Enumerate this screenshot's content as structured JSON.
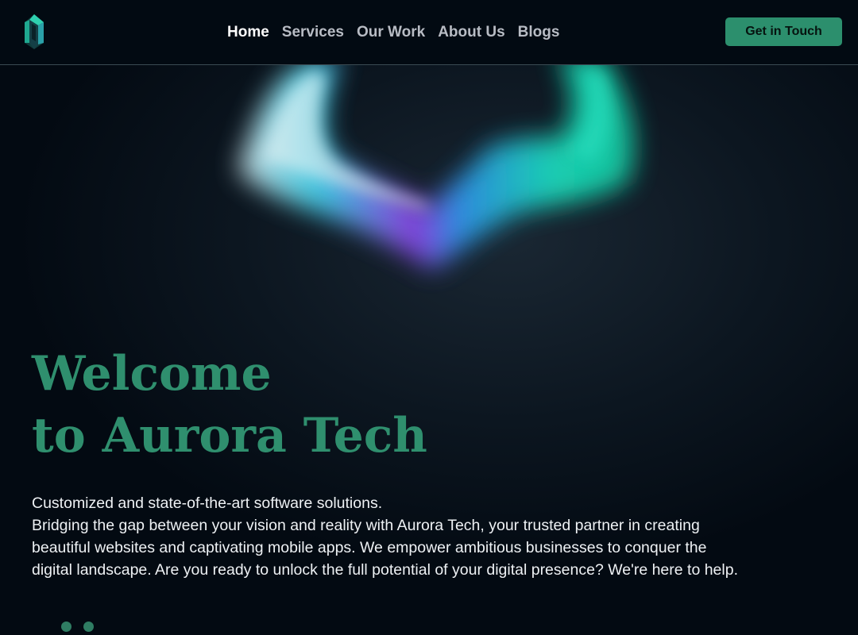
{
  "header": {
    "logo_icon": "aurora-crystal-logo-icon",
    "nav": [
      {
        "label": "Home",
        "active": true
      },
      {
        "label": "Services",
        "active": false
      },
      {
        "label": "Our Work",
        "active": false
      },
      {
        "label": "About Us",
        "active": false
      },
      {
        "label": "Blogs",
        "active": false
      }
    ],
    "cta_label": "Get in Touch"
  },
  "hero": {
    "title_line1": "Welcome",
    "title_line2": "to Aurora Tech",
    "subtitle": "Customized and state-of-the-art software solutions.",
    "body_line1": "Bridging the gap between your vision and reality with Aurora Tech, your trusted partner in creating",
    "body_line2": "beautiful websites and captivating mobile apps. We empower ambitious businesses to conquer the",
    "body_line3": "digital landscape. Are you ready to unlock the full potential of your digital presence? We're here to help."
  },
  "carousel": {
    "dot_count": 2
  },
  "colors": {
    "background": "#020a12",
    "accent": "#2f8f6e",
    "cta_background": "#2c8f6d",
    "nav_active": "#ffffff",
    "nav_inactive": "#b8bcc4"
  }
}
